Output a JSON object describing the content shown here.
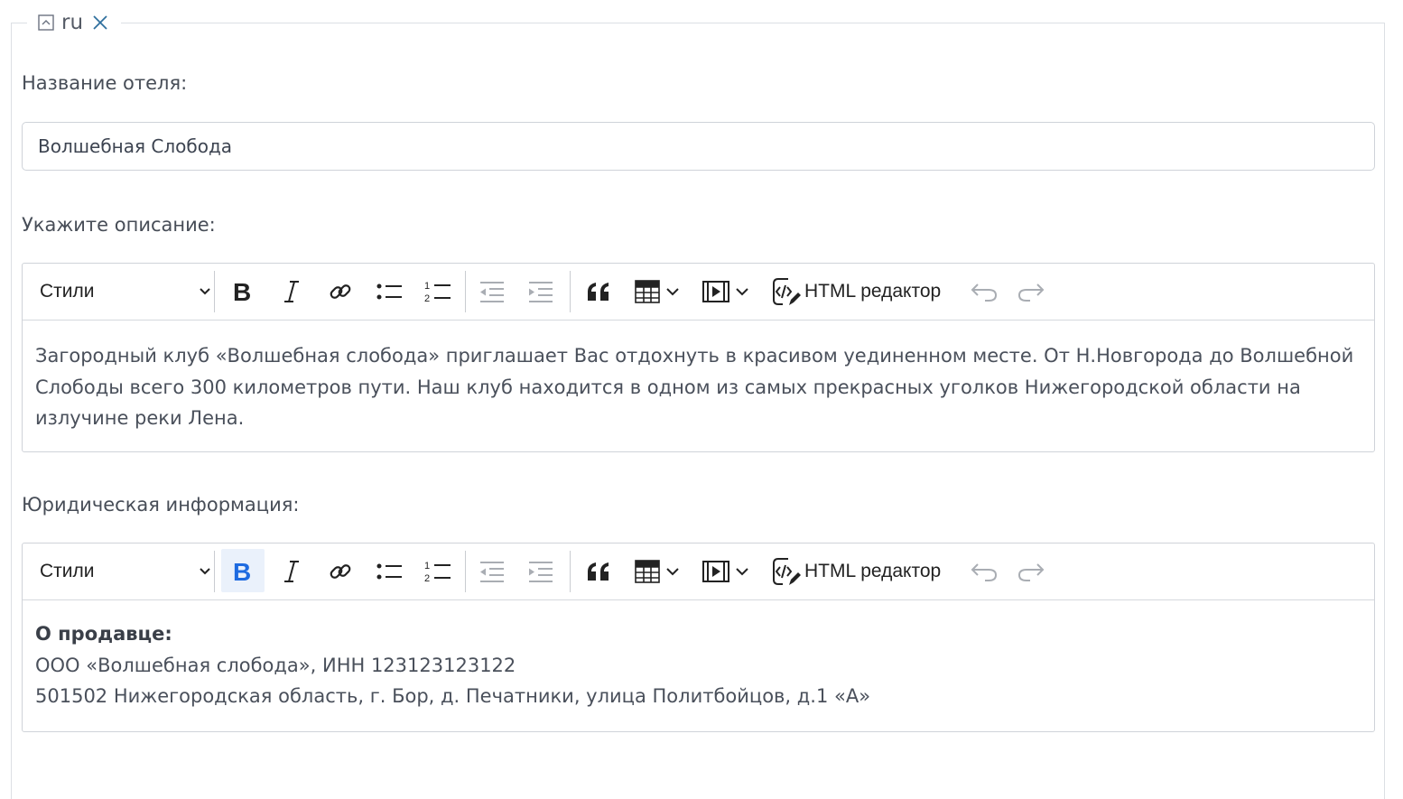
{
  "section": {
    "language": "ru",
    "collapse_icon": "collapse-icon",
    "remove_icon": "close-icon"
  },
  "hotel_name": {
    "label": "Название отеля:",
    "value": "Волшебная Слобода"
  },
  "description": {
    "label": "Укажите описание:",
    "toolbar": {
      "styles_label": "Стили",
      "html_label": "HTML редактор",
      "bold_active": false
    },
    "content": "Загородный клуб «Волшебная слобода» приглашает Вас отдохнуть в красивом уединенном месте. От Н.Новгорода до Волшебной Слободы всего 300 километров пути. Наш клуб находится в одном из самых прекрасных уголков Нижегородской области на излучине реки Лена."
  },
  "legal": {
    "label": "Юридическая информация:",
    "toolbar": {
      "styles_label": "Стили",
      "html_label": "HTML редактор",
      "bold_active": true
    },
    "lines": [
      "О продавце:",
      "ООО «Волшебная слобода», ИНН 123123123122",
      "501502 Нижегородская область, г. Бор, д. Печатники, улица Политбойцов, д.1 «А»"
    ]
  },
  "colors": {
    "border": "#cfd3d9",
    "text": "#3d4451",
    "active_bold": "#1e6be0",
    "active_bold_bg": "#eaf1fb",
    "remove_icon": "#2f6f9e"
  }
}
